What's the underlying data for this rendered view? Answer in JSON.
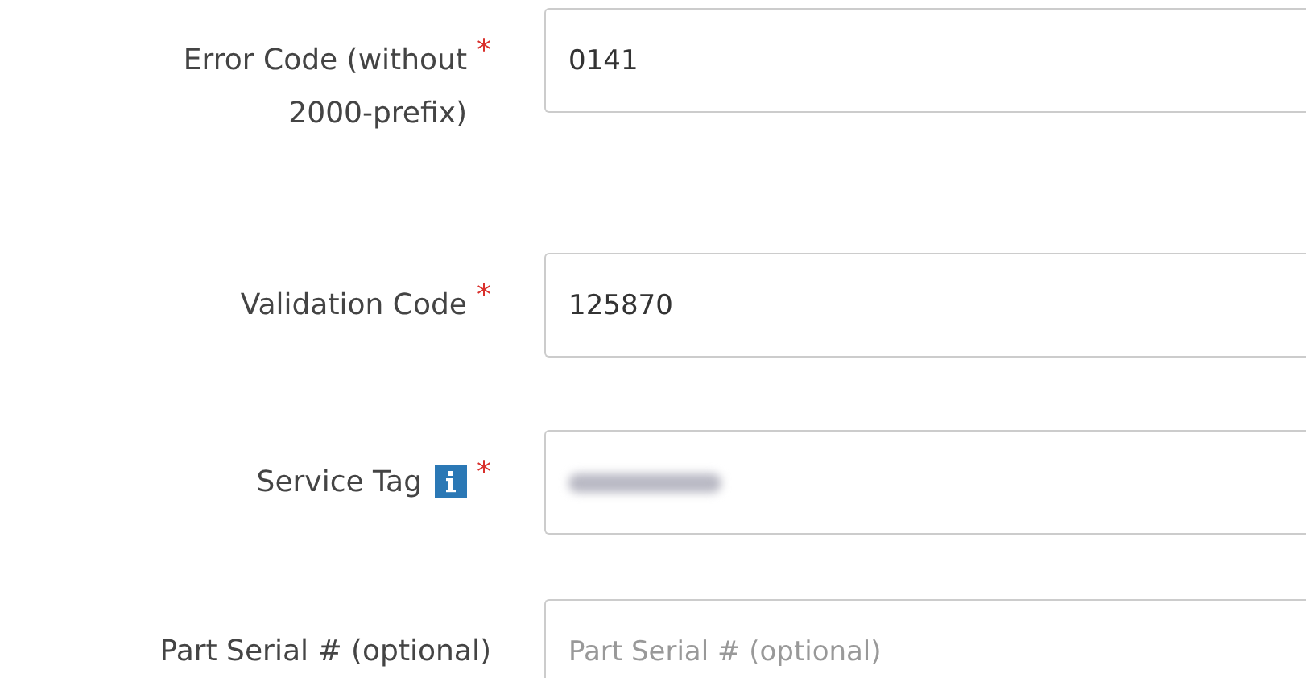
{
  "form": {
    "fields": [
      {
        "label": "Error Code (without 2000-prefix)",
        "required_mark": "*",
        "value": "0141"
      },
      {
        "label": "Validation Code",
        "required_mark": "*",
        "value": "125870"
      },
      {
        "label": "Service Tag",
        "info": true,
        "required_mark": "*",
        "value_hidden": true
      },
      {
        "label": "Part Serial # (optional)",
        "placeholder": "Part Serial # (optional)"
      }
    ]
  }
}
